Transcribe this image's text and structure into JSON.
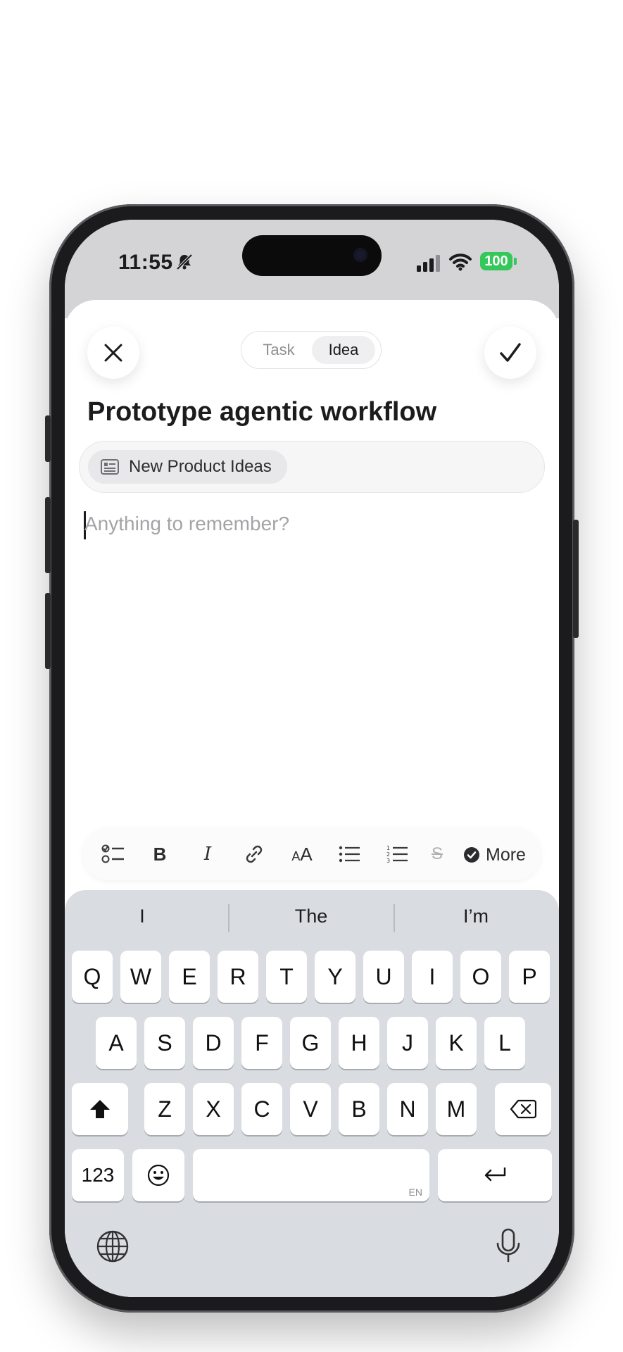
{
  "status_bar": {
    "time": "11:55",
    "battery": "100"
  },
  "header": {
    "close_icon": "close-icon",
    "confirm_icon": "checkmark-icon",
    "tabs": [
      "Task",
      "Idea"
    ],
    "selected_tab": "Idea"
  },
  "item": {
    "title": "Prototype agentic workflow",
    "list_label": "New Product Ideas",
    "note_placeholder": "Anything to remember?"
  },
  "format_bar": {
    "tools": [
      "checklist-icon",
      "bold-icon",
      "italic-icon",
      "link-icon",
      "text-size-icon",
      "bullet-list-icon",
      "numbered-list-icon",
      "strikethrough-icon"
    ],
    "more_label": "More"
  },
  "keyboard": {
    "suggestions": [
      "I",
      "The",
      "I’m"
    ],
    "row1": [
      "Q",
      "W",
      "E",
      "R",
      "T",
      "Y",
      "U",
      "I",
      "O",
      "P"
    ],
    "row2": [
      "A",
      "S",
      "D",
      "F",
      "G",
      "H",
      "J",
      "K",
      "L"
    ],
    "row3": [
      "Z",
      "X",
      "C",
      "V",
      "B",
      "N",
      "M"
    ],
    "numbers_label": "123",
    "space_lang": "EN"
  },
  "colors": {
    "battery": "#34c759",
    "keyboard_bg": "#d9dce0"
  }
}
